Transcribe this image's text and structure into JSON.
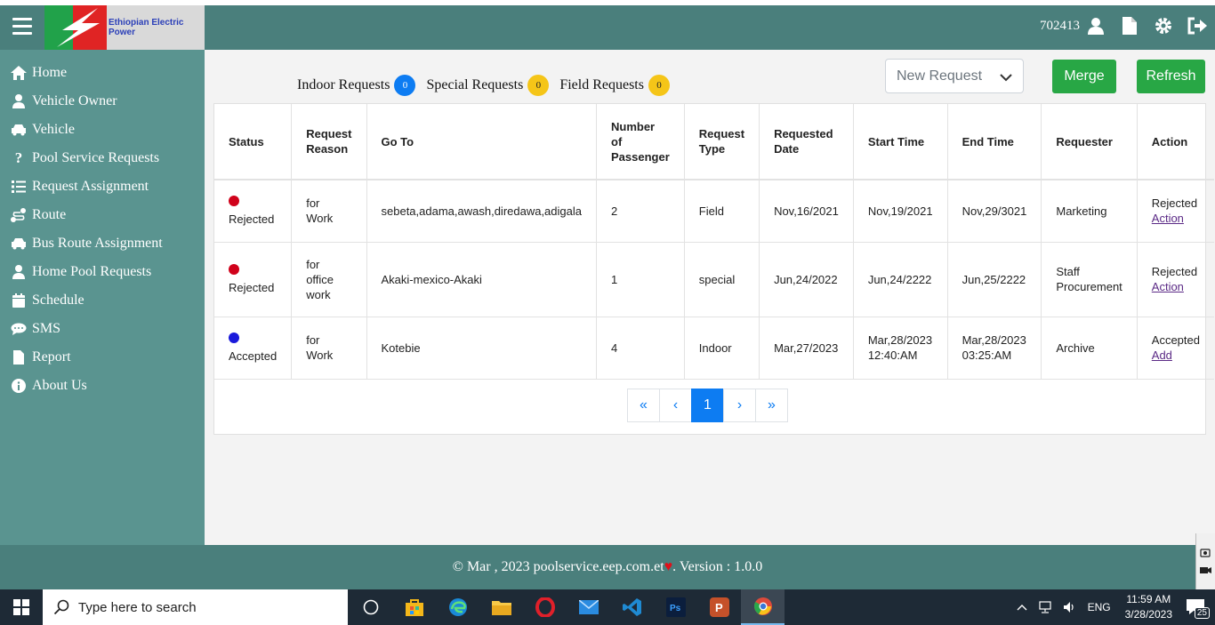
{
  "header": {
    "logo_text": "Ethiopian Electric Power",
    "user_id": "702413",
    "icons": [
      "menu-icon",
      "user-icon",
      "file-icon",
      "gear-icon",
      "logout-icon"
    ]
  },
  "sidebar": {
    "items": [
      {
        "label": "Home",
        "icon": "home-icon"
      },
      {
        "label": "Vehicle Owner",
        "icon": "user-icon"
      },
      {
        "label": "Vehicle",
        "icon": "car-icon"
      },
      {
        "label": "Pool Service Requests",
        "icon": "question-icon"
      },
      {
        "label": "Request Assignment",
        "icon": "list-icon"
      },
      {
        "label": "Route",
        "icon": "route-icon"
      },
      {
        "label": "Bus Route Assignment",
        "icon": "car-icon"
      },
      {
        "label": "Home Pool Requests",
        "icon": "user-icon"
      },
      {
        "label": "Schedule",
        "icon": "calendar-icon"
      },
      {
        "label": "SMS",
        "icon": "sms-icon"
      },
      {
        "label": "Report",
        "icon": "file-icon"
      },
      {
        "label": "About Us",
        "icon": "info-icon"
      }
    ]
  },
  "counters": {
    "indoor_label": "Indoor Requests",
    "indoor_count": "0",
    "special_label": "Special Requests",
    "special_count": "0",
    "field_label": "Field Requests",
    "field_count": "0"
  },
  "toolbar": {
    "select_value": "New Request",
    "merge_label": "Merge",
    "refresh_label": "Refresh"
  },
  "table": {
    "headers": {
      "status": "Status",
      "reason": [
        "Request",
        "Reason"
      ],
      "goto": "Go To",
      "passengers": [
        "Number",
        "of",
        "Passenger"
      ],
      "type": [
        "Request",
        "Type"
      ],
      "requested": [
        "Requested",
        "Date"
      ],
      "start": "Start Time",
      "end": "End Time",
      "requester": "Requester",
      "action": "Action"
    },
    "rows": [
      {
        "status": "Rejected",
        "status_color": "#d0021b",
        "reason": [
          "for",
          "Work"
        ],
        "goto": "sebeta,adama,awash,diredawa,adigala",
        "passengers": "2",
        "type": "Field",
        "requested": "Nov,16/2021",
        "start": [
          "Nov,19/2021"
        ],
        "end": [
          "Nov,29/3021"
        ],
        "requester": [
          "Marketing"
        ],
        "action_status": "Rejected",
        "action_link": "Action"
      },
      {
        "status": "Rejected",
        "status_color": "#d0021b",
        "reason": [
          "for",
          "office",
          "work"
        ],
        "goto": "Akaki-mexico-Akaki",
        "passengers": "1",
        "type": "special",
        "requested": "Jun,24/2022",
        "start": [
          "Jun,24/2222"
        ],
        "end": [
          "Jun,25/2222"
        ],
        "requester": [
          "Staff",
          "Procurement"
        ],
        "action_status": "Rejected",
        "action_link": "Action"
      },
      {
        "status": "Accepted",
        "status_color": "#1a1adb",
        "reason": [
          "for",
          "Work"
        ],
        "goto": "Kotebie",
        "passengers": "4",
        "type": "Indoor",
        "requested": "Mar,27/2023",
        "start": [
          "Mar,28/2023",
          "12:40:AM"
        ],
        "end": [
          "Mar,28/2023",
          "03:25:AM"
        ],
        "requester": [
          "Archive"
        ],
        "action_status": "Accepted",
        "action_link": "Add"
      }
    ]
  },
  "pagination": {
    "first": "«",
    "prev": "‹",
    "current": "1",
    "next": "›",
    "last": "»"
  },
  "footer": {
    "prefix": "© Mar , 2023 poolservice.eep.com.et",
    "heart": "♥",
    "suffix": ". Version : 1.0.0"
  },
  "taskbar": {
    "search_placeholder": "Type here to search",
    "lang": "ENG",
    "time": "11:59 AM",
    "date": "3/28/2023",
    "notifications": "25"
  },
  "colors": {
    "header": "#4a7f7c",
    "sidebar": "#5a9490",
    "primary": "#0d7cf2",
    "success": "#28a745"
  }
}
